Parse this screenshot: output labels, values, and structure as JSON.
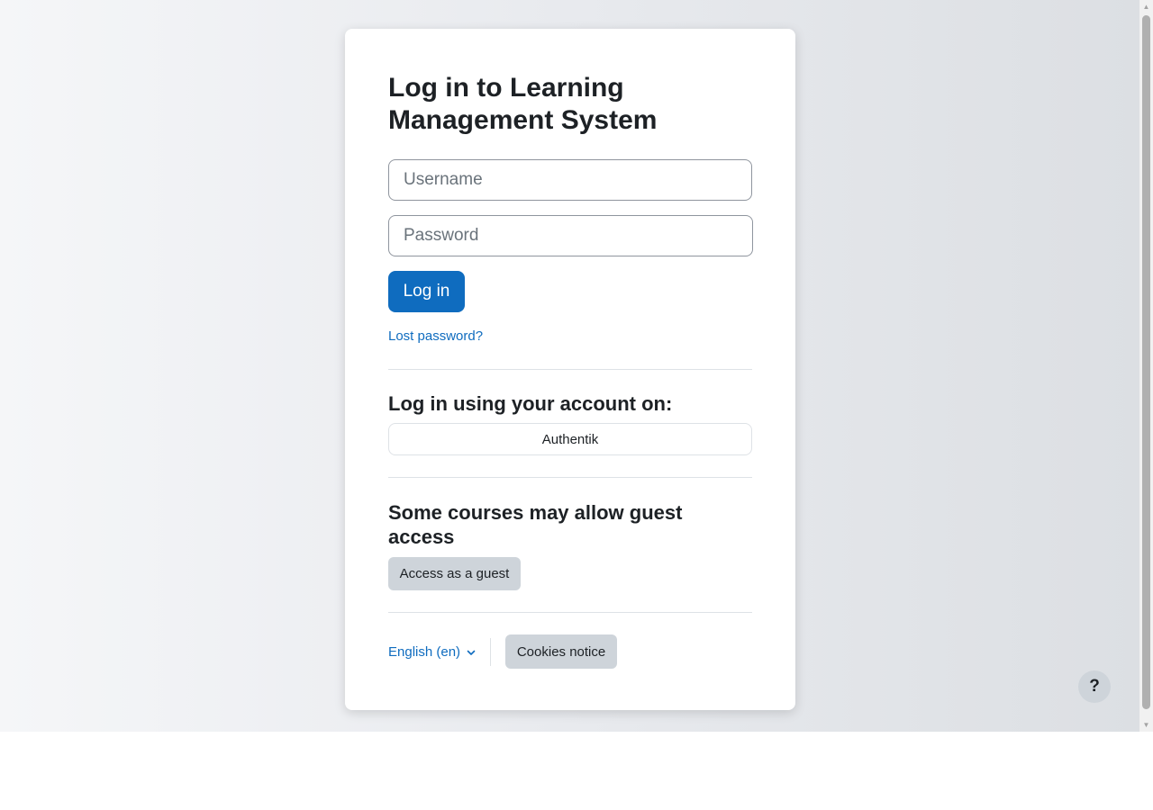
{
  "login": {
    "title": "Log in to Learning Management System",
    "username_placeholder": "Username",
    "password_placeholder": "Password",
    "login_button": "Log in",
    "lost_password": "Lost password?"
  },
  "identity_providers": {
    "heading": "Log in using your account on:",
    "providers": [
      "Authentik"
    ]
  },
  "guest": {
    "heading": "Some courses may allow guest access",
    "button": "Access as a guest"
  },
  "footer": {
    "language": "English (en)",
    "cookies_button": "Cookies notice"
  },
  "help": {
    "label": "?"
  },
  "icons": {
    "language_dropdown": "chevron-down-icon",
    "scroll_up": "arrow-up-icon",
    "scroll_down": "arrow-down-icon"
  },
  "colors": {
    "primary": "#0f6cbf",
    "secondary_button": "#ced4da",
    "text": "#1d2125"
  }
}
